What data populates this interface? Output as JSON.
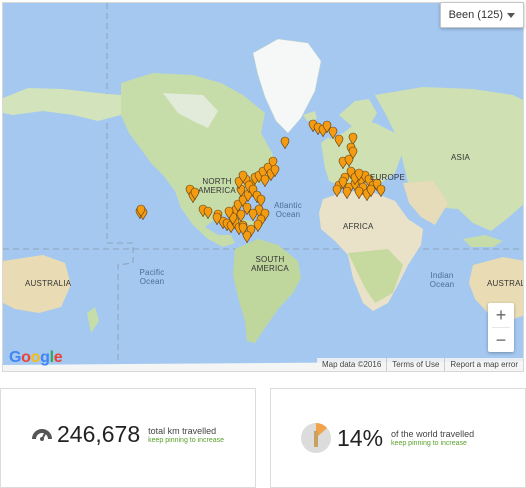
{
  "filter": {
    "label": "Been (125)"
  },
  "map": {
    "continent_labels": [
      "NORTH AMERICA",
      "SOUTH AMERICA",
      "AFRICA",
      "EUROPE",
      "ASIA",
      "AUSTRALIA",
      "AUSTRALIA"
    ],
    "ocean_labels": [
      "Atlantic Ocean",
      "Pacific Ocean",
      "Indian Ocean"
    ],
    "attribution": {
      "data": "Map data ©2016",
      "terms": "Terms of Use",
      "report": "Report a map error"
    },
    "google_letters": [
      "G",
      "o",
      "o",
      "g",
      "l",
      "e"
    ],
    "google_colors": [
      "#4285F4",
      "#EA4335",
      "#FBBC05",
      "#4285F4",
      "#34A853",
      "#EA4335"
    ],
    "zoom_in": "+",
    "zoom_out": "−",
    "pin_color": "#f39c12"
  },
  "stats": {
    "distance": {
      "value": "246,678",
      "label": "total km travelled",
      "sub": "keep pinning to increase"
    },
    "world": {
      "value": "14%",
      "label": "of the world travelled",
      "sub": "keep pinning to increase"
    }
  }
}
